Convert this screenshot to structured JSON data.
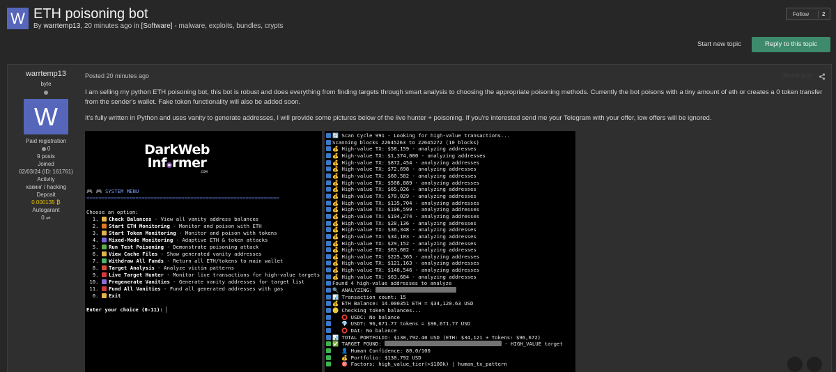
{
  "topic": {
    "avatar_letter": "W",
    "title": "ETH poisoning bot",
    "by": "By",
    "author": "warrtemp13",
    "time": ", 20 minutes ago in ",
    "forum": "[Software]",
    "tags": " - malware, exploits, bundles, crypts"
  },
  "actions": {
    "follow_label": "Follow",
    "follow_count": "2",
    "start_new_topic": "Start new topic",
    "reply": "Reply to this topic"
  },
  "author": {
    "username": "warrtemp13",
    "rank": "byte",
    "avatar_letter": "W",
    "group": "Paid registration",
    "rep": "0",
    "posts": "9 posts",
    "joined_label": "Joined",
    "joined": "02/03/24 (ID: 161761)",
    "activity_label": "Activity",
    "activity": "хакинг / hacking",
    "deposit_label": "Deposit",
    "deposit": "0.000135",
    "autogarant_label": "Autogarant",
    "autogarant": "0"
  },
  "post": {
    "posted": "Posted 20 minutes ago",
    "report": "Report post",
    "para1": "I am selling my python ETH poisoning bot, this bot is robust and does everything from finding targets through smart analysis to choosing the appropriate poisoning methods. Currently the bot poisons with a tiny amount of eth or creates a 0 token transfer from the sender's wallet. Fake token functionality will also be added soon.",
    "para2": "It's fully written in Python and uses vanity to generate addresses, I will provide some pictures below of the live hunter + poisoning. If you're interested send me your Telegram with your offer, low offers will be ignored."
  },
  "logo": {
    "line1": "DarkWeb",
    "line2a": "Inf",
    "line2b": "rmer",
    "line3": ".COM"
  },
  "menu": {
    "header": "SYSTEM MENU",
    "rule": "===============================================================",
    "prompt_intro": "Choose an option:",
    "items": [
      {
        "num": "1.",
        "name": "Check Balances",
        "desc": " - View all vanity address balances",
        "color": "#e3b44a"
      },
      {
        "num": "2.",
        "name": "Start ETH Monitoring",
        "desc": " - Monitor and poison with ETH",
        "color": "#e07a1f"
      },
      {
        "num": "3.",
        "name": "Start Token Monitoring",
        "desc": " - Monitor and poison with tokens",
        "color": "#e3b44a"
      },
      {
        "num": "4.",
        "name": "Mixed-Mode Monitoring",
        "desc": " - Adaptive ETH & token attacks",
        "color": "#7a67d8"
      },
      {
        "num": "5.",
        "name": "Run Test Poisoning",
        "desc": " - Demonstrate poisoning attack",
        "color": "#5bb04a"
      },
      {
        "num": "6.",
        "name": "View Cache Files",
        "desc": " - Show generated vanity addresses",
        "color": "#e3b44a"
      },
      {
        "num": "7.",
        "name": "Withdraw All Funds",
        "desc": " - Return all ETH/tokens to main wallet",
        "color": "#4fb36a"
      },
      {
        "num": "8.",
        "name": "Target Analysis",
        "desc": " - Analyze victim patterns",
        "color": "#d64a3a"
      },
      {
        "num": "9.",
        "name": "Live Target Hunter",
        "desc": " - Monitor live transactions for high-value targets",
        "color": "#d63a3a"
      },
      {
        "num": "10.",
        "name": "Pregenerate Vanities",
        "desc": " - Generate vanity addresses for target list",
        "color": "#8a6ed0"
      },
      {
        "num": "11.",
        "name": "Fund All Vanities",
        "desc": " - Fund all generated addresses with gas",
        "color": "#c93a3a"
      },
      {
        "num": "0.",
        "name": "Exit",
        "desc": "",
        "color": "#e3b44a"
      }
    ],
    "input_prompt": "Enter your choice (0-11): "
  },
  "terminal": {
    "lines": [
      {
        "chip": "i",
        "text": "🔄 Scan Cycle 991 - Looking for high-value transactions..."
      },
      {
        "chip": "i",
        "text": "Scanning blocks 22645263 to 22645272 (10 blocks)"
      },
      {
        "chip": "i",
        "text": "💰 High-value TX: $58,159 - analyzing addresses"
      },
      {
        "chip": "i",
        "text": "💰 High-value TX: $1,374,000 - analyzing addresses"
      },
      {
        "chip": "i",
        "text": "💰 High-value TX: $872,454 - analyzing addresses"
      },
      {
        "chip": "i",
        "text": "💰 High-value TX: $72,698 - analyzing addresses"
      },
      {
        "chip": "i",
        "text": "💰 High-value TX: $60,582 - analyzing addresses"
      },
      {
        "chip": "i",
        "text": "💰 High-value TX: $508,889 - analyzing addresses"
      },
      {
        "chip": "i",
        "text": "💰 High-value TX: $65,026 - analyzing addresses"
      },
      {
        "chip": "i",
        "text": "💰 High-value TX: $70,029 - analyzing addresses"
      },
      {
        "chip": "i",
        "text": "💰 High-value TX: $135,704 - analyzing addresses"
      },
      {
        "chip": "i",
        "text": "💰 High-value TX: $106,599 - analyzing addresses"
      },
      {
        "chip": "i",
        "text": "💰 High-value TX: $194,274 - analyzing addresses"
      },
      {
        "chip": "i",
        "text": "💰 High-value TX: $28,136 - analyzing addresses"
      },
      {
        "chip": "i",
        "text": "💰 High-value TX: $36,348 - analyzing addresses"
      },
      {
        "chip": "i",
        "text": "💰 High-value TX: $34,103 - analyzing addresses"
      },
      {
        "chip": "i",
        "text": "💰 High-value TX: $29,152 - analyzing addresses"
      },
      {
        "chip": "i",
        "text": "💰 High-value TX: $63,682 - analyzing addresses"
      },
      {
        "chip": "i",
        "text": "💰 High-value TX: $225,365 - analyzing addresses"
      },
      {
        "chip": "i",
        "text": "💰 High-value TX: $121,163 - analyzing addresses"
      },
      {
        "chip": "i",
        "text": "💰 High-value TX: $148,546 - analyzing addresses"
      },
      {
        "chip": "i",
        "text": "💰 High-value TX: $63,684 - analyzing addresses"
      },
      {
        "chip": "i",
        "text": "Found 4 high-value addresses to analyze"
      },
      {
        "chip": "i",
        "text": "🔍 ANALYZING: ",
        "blur": 116
      },
      {
        "chip": "i",
        "text": "📊 Transaction count: 15"
      },
      {
        "chip": "i",
        "text": "💰 ETH Balance: 14.000351 ETH = $34,120.63 USD"
      },
      {
        "chip": "i",
        "text": "🪙 Checking token balances..."
      },
      {
        "chip": "i",
        "text": "   ⭕ USDC: No balance"
      },
      {
        "chip": "i",
        "text": "   💎 USDT: 96,671.77 tokens = $96,671.77 USD"
      },
      {
        "chip": "i",
        "text": "   ⭕ DAI: No balance"
      },
      {
        "chip": "i",
        "text": "📊 TOTAL PORTFOLIO: $130,792.40 USD (ETH: $34,121 + Tokens: $96,672)"
      },
      {
        "chip": "g",
        "text": "✅ TARGET FOUND: ",
        "blur": 168,
        "after": " - HIGH_VALUE target"
      },
      {
        "chip": "g",
        "text": "   👤 Human Confidence: 80.0/100"
      },
      {
        "chip": "g",
        "text": "   💰 Portfolio: $130,792 USD"
      },
      {
        "chip": "g",
        "text": "   🎯 Factors: high_value_tier(>$100k) | human_tx_pattern"
      }
    ]
  },
  "colors": {
    "background": "#272727",
    "post_bg": "#2f2f2f",
    "reply_button": "#3e8a6d",
    "avatar": "#5566bb",
    "deposit": "#e8c200"
  },
  "icons": [
    "share-icon",
    "bitcoin-icon",
    "handshake-icon",
    "reputation-ring-icon"
  ]
}
